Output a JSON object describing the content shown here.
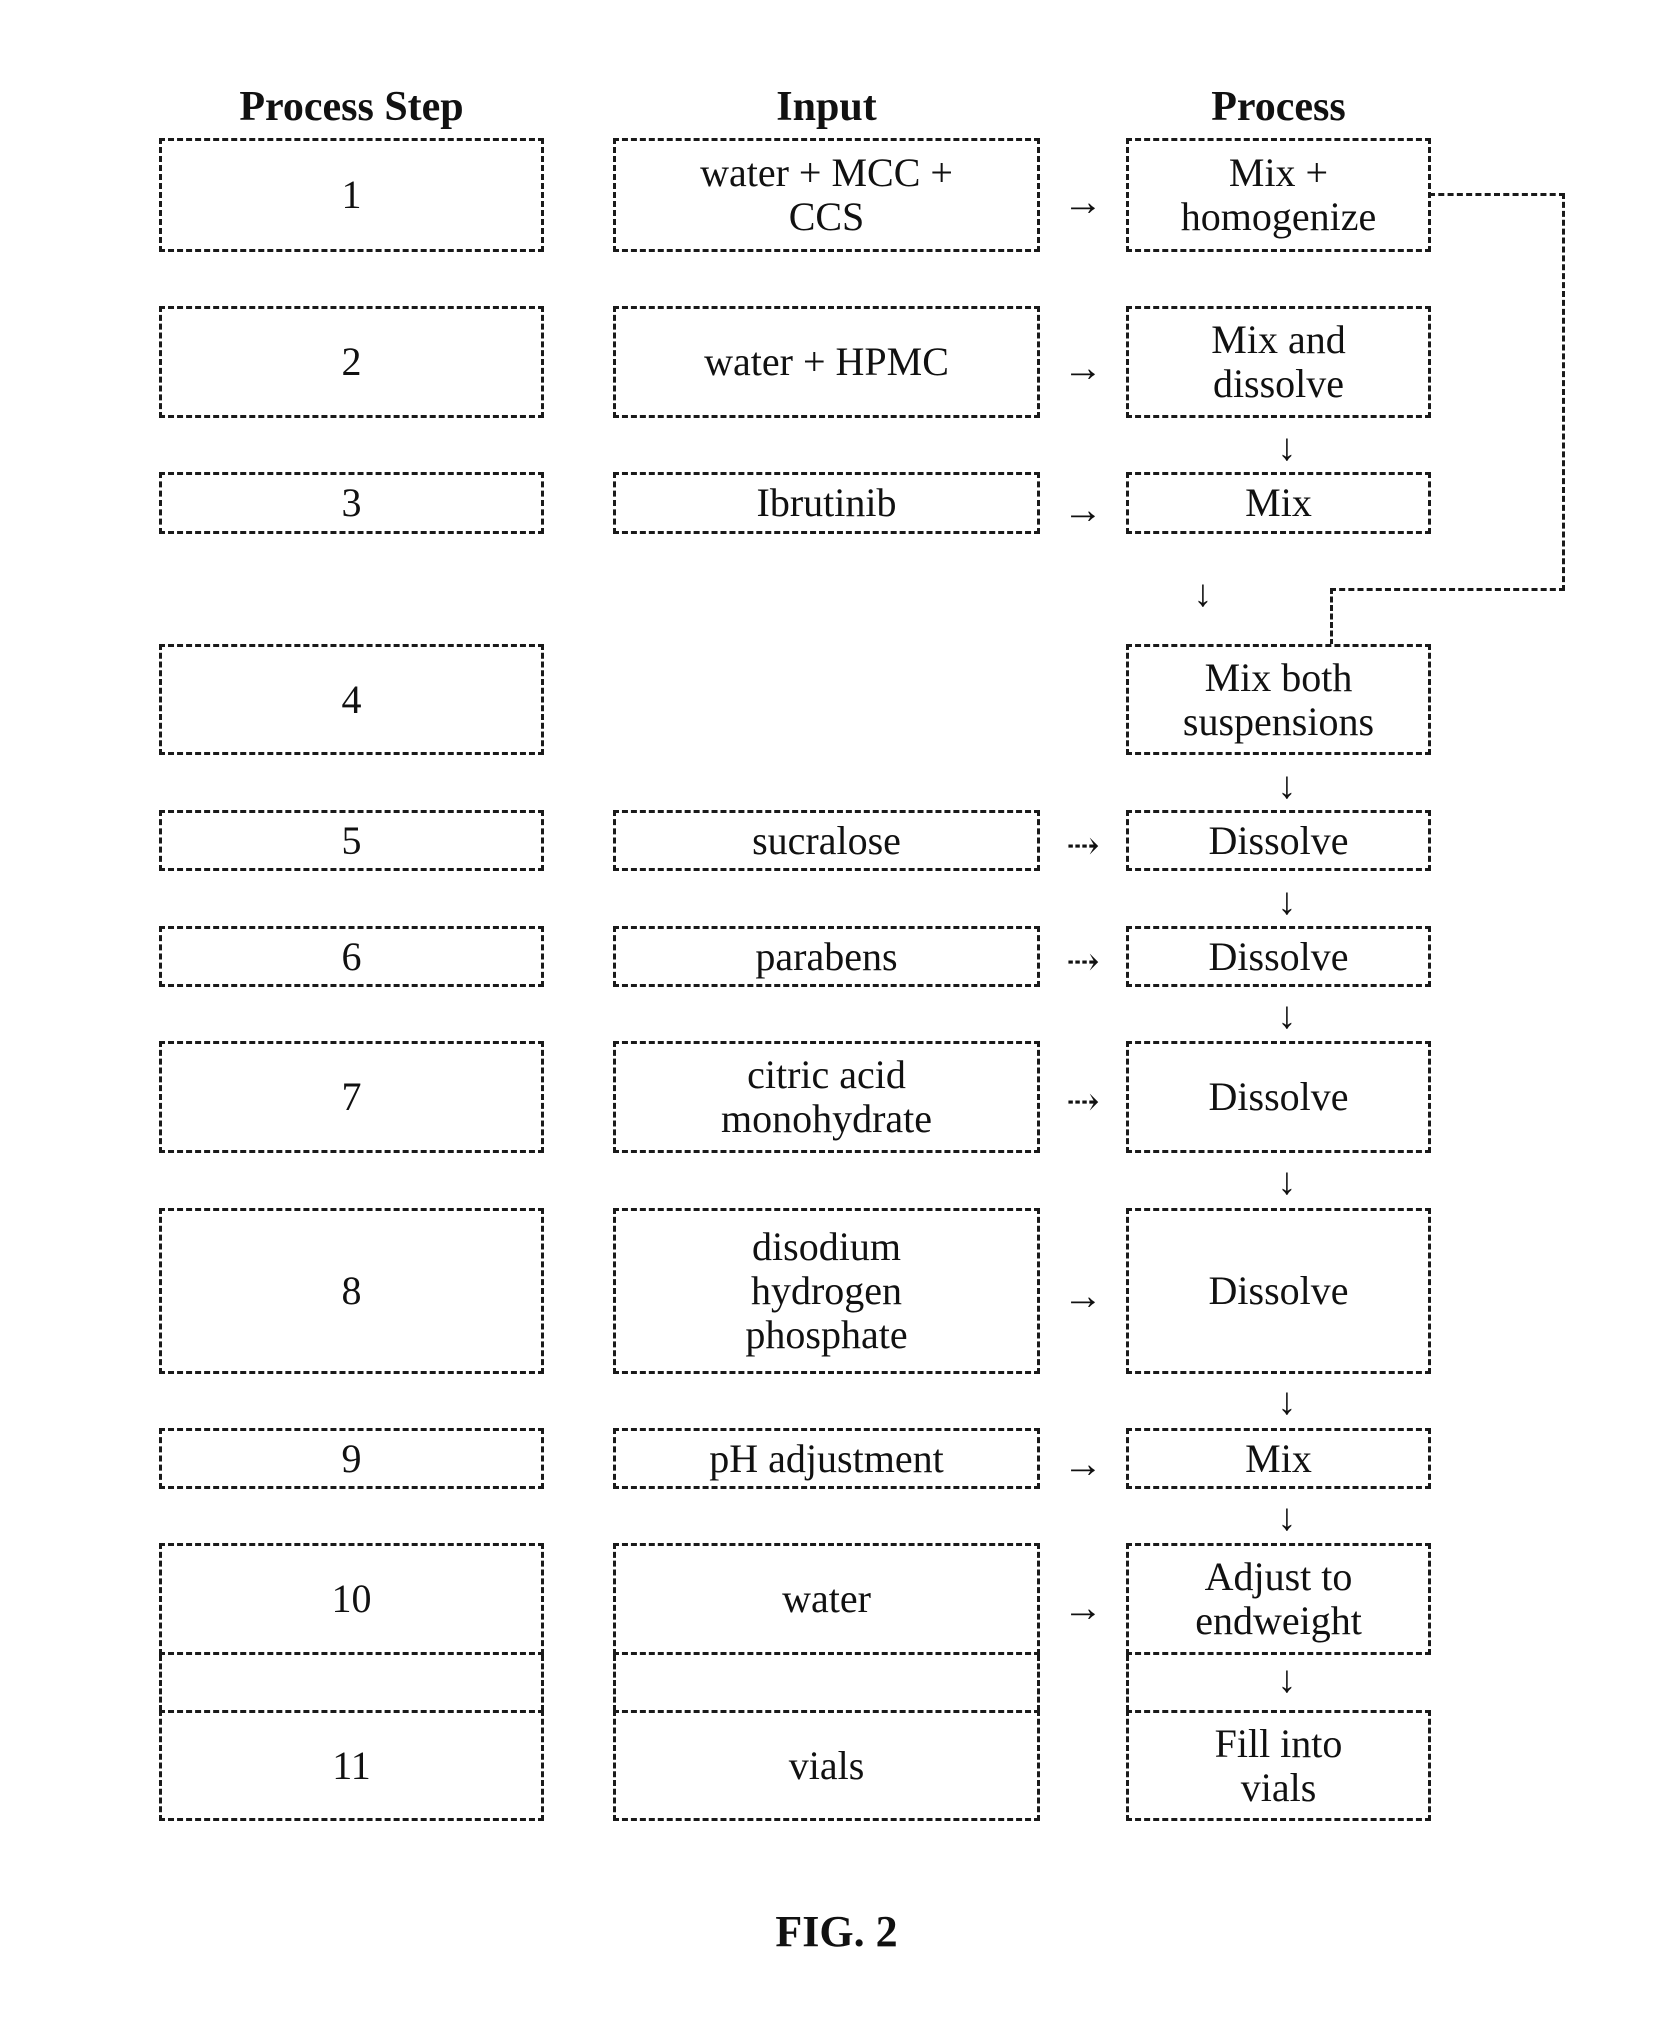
{
  "headers": {
    "step": "Process Step",
    "input": "Input",
    "process": "Process"
  },
  "rows": [
    {
      "step": "1",
      "input": "water + MCC +\nCCS",
      "process": "Mix +\nhomogenize",
      "input_arrow": "→"
    },
    {
      "step": "2",
      "input": "water + HPMC",
      "process": "Mix and\ndissolve",
      "input_arrow": "→"
    },
    {
      "step": "3",
      "input": "Ibrutinib",
      "process": "Mix",
      "input_arrow": "→"
    },
    {
      "step": "4",
      "input": "",
      "process": "Mix both\nsuspensions",
      "input_arrow": ""
    },
    {
      "step": "5",
      "input": "sucralose",
      "process": "Dissolve",
      "input_arrow": "⇢"
    },
    {
      "step": "6",
      "input": "parabens",
      "process": "Dissolve",
      "input_arrow": "⇢"
    },
    {
      "step": "7",
      "input": "citric acid\nmonohydrate",
      "process": "Dissolve",
      "input_arrow": "⇢"
    },
    {
      "step": "8",
      "input": "disodium\nhydrogen\nphosphate",
      "process": "Dissolve",
      "input_arrow": "→"
    },
    {
      "step": "9",
      "input": "pH adjustment",
      "process": "Mix",
      "input_arrow": "→"
    },
    {
      "step": "10",
      "input": "water",
      "process": "Adjust to\nendweight",
      "input_arrow": "→"
    },
    {
      "step": "11",
      "input": "vials",
      "process": "Fill into\nvials",
      "input_arrow": ""
    }
  ],
  "down_arrow": "↓",
  "caption": "FIG. 2"
}
